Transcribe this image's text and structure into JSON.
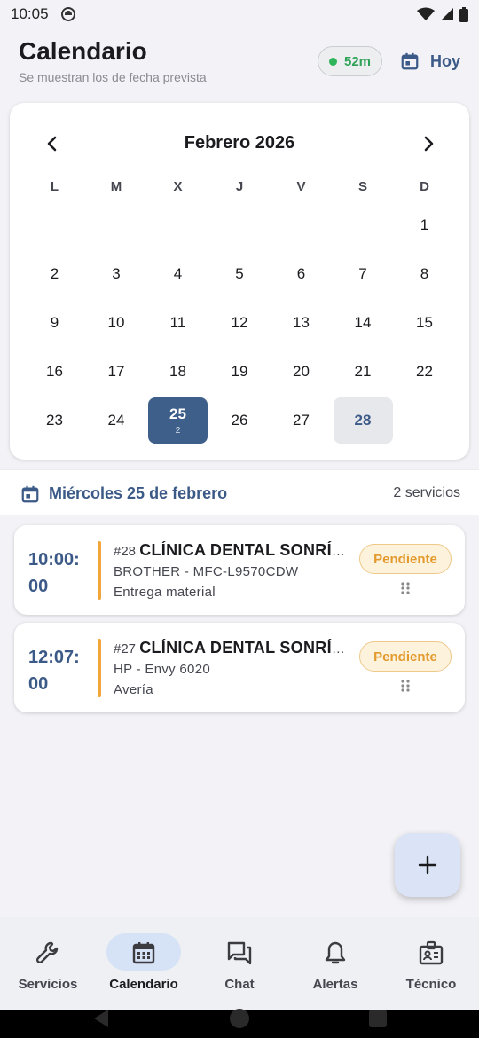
{
  "status_bar": {
    "time": "10:05"
  },
  "header": {
    "title": "Calendario",
    "subtitle": "Se muestran los de fecha prevista",
    "timer": "52m",
    "today_button": "Hoy"
  },
  "calendar": {
    "month_label": "Febrero 2026",
    "weekdays": [
      "L",
      "M",
      "X",
      "J",
      "V",
      "S",
      "D"
    ],
    "weeks": [
      [
        "",
        "",
        "",
        "",
        "",
        "",
        "1"
      ],
      [
        "2",
        "3",
        "4",
        "5",
        "6",
        "7",
        "8"
      ],
      [
        "9",
        "10",
        "11",
        "12",
        "13",
        "14",
        "15"
      ],
      [
        "16",
        "17",
        "18",
        "19",
        "20",
        "21",
        "22"
      ],
      [
        "23",
        "24",
        "25",
        "26",
        "27",
        "28",
        ""
      ]
    ],
    "selected_day": "25",
    "selected_day_count": "2",
    "today": "28"
  },
  "day_header": {
    "title": "Miércoles 25 de febrero",
    "count": "2 servicios"
  },
  "services": [
    {
      "time": "10:00:00",
      "number": "#28",
      "client": "CLÍNICA DENTAL SONRÍENDO",
      "device": "BROTHER - MFC-L9570CDW",
      "type": "Entrega material",
      "status": "Pendiente",
      "accent": "#f2a63a"
    },
    {
      "time": "12:07:00",
      "number": "#27",
      "client": "CLÍNICA DENTAL SONRÍENDO",
      "device": "HP - Envy 6020",
      "type": "Avería",
      "status": "Pendiente",
      "accent": "#f2a63a"
    }
  ],
  "fab": {
    "icon": "plus-icon"
  },
  "bottom_nav": [
    {
      "label": "Servicios",
      "icon": "wrench-icon",
      "active": false
    },
    {
      "label": "Calendario",
      "icon": "calendar-icon",
      "active": true
    },
    {
      "label": "Chat",
      "icon": "chat-icon",
      "active": false
    },
    {
      "label": "Alertas",
      "icon": "bell-icon",
      "active": false
    },
    {
      "label": "Técnico",
      "icon": "id-badge-icon",
      "active": false
    }
  ],
  "colors": {
    "primary": "#3c5a87",
    "selected_day": "#3e5f8a",
    "status_pending": "#e39a2e",
    "timer_green": "#2fa257"
  }
}
